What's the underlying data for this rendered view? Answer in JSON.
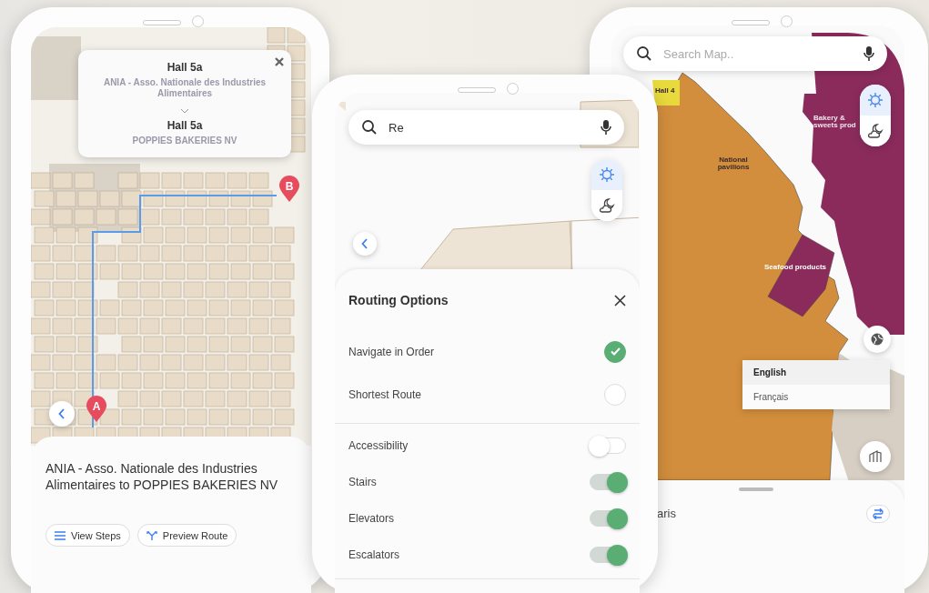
{
  "left_phone": {
    "popup": {
      "origin_hall": "Hall 5a",
      "origin_name": "ANIA - Asso. Nationale des Industries Alimentaires",
      "destination_hall": "Hall 5a",
      "destination_name": "POPPIES BAKERIES NV"
    },
    "markers": [
      {
        "label": "A"
      },
      {
        "label": "B"
      }
    ],
    "route_title": "ANIA - Asso. Nationale des Industries Alimentaires to POPPIES BAKERIES NV",
    "buttons": [
      {
        "kind": "steps",
        "label": "View Steps"
      },
      {
        "kind": "preview",
        "label": "Preview Route"
      }
    ]
  },
  "middle_phone": {
    "search": {
      "value": "Re"
    },
    "theme_toggle": [
      {
        "kind": "light",
        "selected": true
      },
      {
        "kind": "dark",
        "selected": false
      }
    ],
    "routing_options": {
      "title": "Routing Options",
      "modes": [
        {
          "label": "Navigate in Order",
          "selected": true
        },
        {
          "label": "Shortest Route",
          "selected": false
        }
      ],
      "toggles": [
        {
          "label": "Accessibility",
          "on": false
        },
        {
          "label": "Stairs",
          "on": true
        },
        {
          "label": "Elevators",
          "on": true
        },
        {
          "label": "Escalators",
          "on": true
        }
      ]
    }
  },
  "right_phone": {
    "search": {
      "placeholder": "Search Map.."
    },
    "theme_toggle": [
      {
        "kind": "light",
        "selected": true
      },
      {
        "kind": "dark",
        "selected": false
      }
    ],
    "map_labels": [
      {
        "kind": "hall",
        "text": "Hall 4"
      },
      {
        "kind": "zone",
        "text": "National pavilions"
      },
      {
        "kind": "zone",
        "text": "Bakery & sweets prod"
      },
      {
        "kind": "zone",
        "text": "Seafood products"
      }
    ],
    "languages": [
      {
        "label": "English",
        "selected": true
      },
      {
        "label": "Français",
        "selected": false
      }
    ],
    "sheet": {
      "title": "aris"
    }
  }
}
